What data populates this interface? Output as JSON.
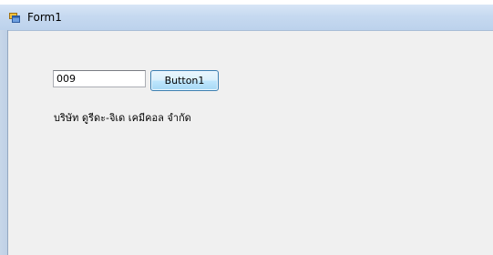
{
  "window": {
    "title": "Form1",
    "icon": "form-icon"
  },
  "form": {
    "textbox_value": "009",
    "button_label": "Button1",
    "label_text": "บริษัท ดูรีดะ-จิเด เคมีคอล จำกัด"
  }
}
